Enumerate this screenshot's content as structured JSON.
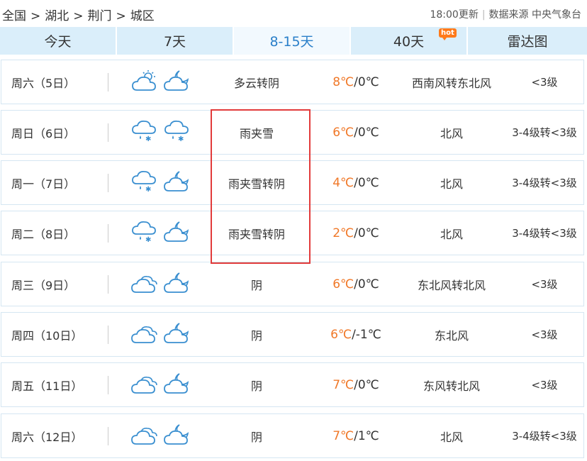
{
  "breadcrumb": {
    "items": [
      "全国",
      "湖北",
      "荆门",
      "城区"
    ],
    "separator": ">"
  },
  "update": {
    "time": "18:00更新",
    "source": "数据来源 中央气象台"
  },
  "tabs": [
    {
      "label": "今天",
      "active": false
    },
    {
      "label": "7天",
      "active": false
    },
    {
      "label": "8-15天",
      "active": true
    },
    {
      "label": "40天",
      "active": false,
      "badge": "hot"
    },
    {
      "label": "雷达图",
      "active": false
    }
  ],
  "forecast": [
    {
      "day": "周六（5日）",
      "icons": [
        "sun-cloud-icon",
        "moon-cloud-icon"
      ],
      "desc": "多云转阴",
      "high": "8℃",
      "low": "/0℃",
      "wind": "西南风转东北风",
      "level": "<3级"
    },
    {
      "day": "周日（6日）",
      "icons": [
        "sleet-cloud-icon",
        "sleet-cloud-icon"
      ],
      "desc": "雨夹雪",
      "high": "6℃",
      "low": "/0℃",
      "wind": "北风",
      "level": "3-4级转<3级"
    },
    {
      "day": "周一（7日）",
      "icons": [
        "sleet-cloud-icon",
        "moon-cloud-icon"
      ],
      "desc": "雨夹雪转阴",
      "high": "4℃",
      "low": "/0℃",
      "wind": "北风",
      "level": "3-4级转<3级"
    },
    {
      "day": "周二（8日）",
      "icons": [
        "sleet-cloud-icon",
        "moon-cloud-icon"
      ],
      "desc": "雨夹雪转阴",
      "high": "2℃",
      "low": "/0℃",
      "wind": "北风",
      "level": "3-4级转<3级"
    },
    {
      "day": "周三（9日）",
      "icons": [
        "overcast-cloud-icon",
        "moon-cloud-icon"
      ],
      "desc": "阴",
      "high": "6℃",
      "low": "/0℃",
      "wind": "东北风转北风",
      "level": "<3级"
    },
    {
      "day": "周四（10日）",
      "icons": [
        "overcast-cloud-icon",
        "moon-cloud-icon"
      ],
      "desc": "阴",
      "high": "6℃",
      "low": "/-1℃",
      "wind": "东北风",
      "level": "<3级"
    },
    {
      "day": "周五（11日）",
      "icons": [
        "overcast-cloud-icon",
        "moon-cloud-icon"
      ],
      "desc": "阴",
      "high": "7℃",
      "low": "/0℃",
      "wind": "东风转北风",
      "level": "<3级"
    },
    {
      "day": "周六（12日）",
      "icons": [
        "overcast-cloud-icon",
        "moon-cloud-icon"
      ],
      "desc": "阴",
      "high": "7℃",
      "low": "/1℃",
      "wind": "北风",
      "level": "3-4级转<3级"
    }
  ],
  "colors": {
    "accent": "#2a7fc9",
    "tab_bg": "#daeefa",
    "high_temp": "#f07828",
    "highlight_box": "#e23b3b",
    "icon_stroke": "#3a8fd0"
  }
}
